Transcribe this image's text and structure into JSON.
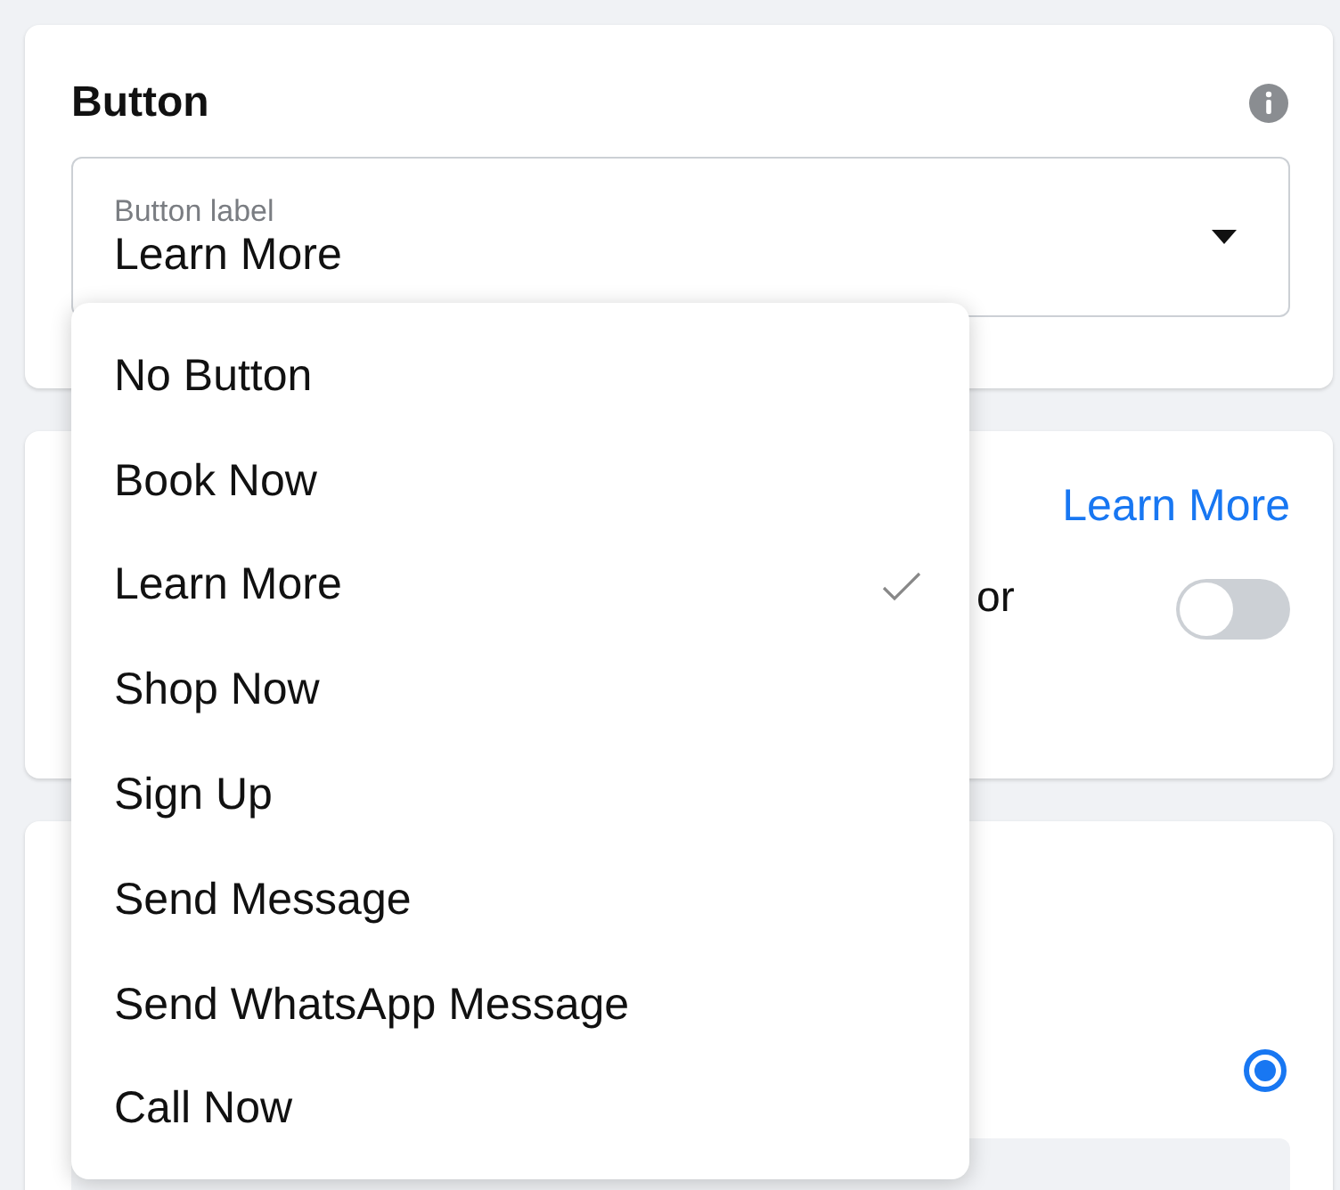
{
  "button_section": {
    "title": "Button",
    "select": {
      "label": "Button label",
      "value": "Learn More"
    }
  },
  "dropdown": {
    "items": [
      {
        "label": "No Button",
        "selected": false
      },
      {
        "label": "Book Now",
        "selected": false
      },
      {
        "label": "Learn More",
        "selected": true
      },
      {
        "label": "Shop Now",
        "selected": false
      },
      {
        "label": "Sign Up",
        "selected": false
      },
      {
        "label": "Send Message",
        "selected": false
      },
      {
        "label": "Send WhatsApp Message",
        "selected": false
      },
      {
        "label": "Call Now",
        "selected": false
      }
    ]
  },
  "second_section": {
    "link": "Learn More",
    "text": "or",
    "toggle": {
      "on": false
    }
  },
  "third_section": {
    "radio": {
      "selected": true
    }
  }
}
